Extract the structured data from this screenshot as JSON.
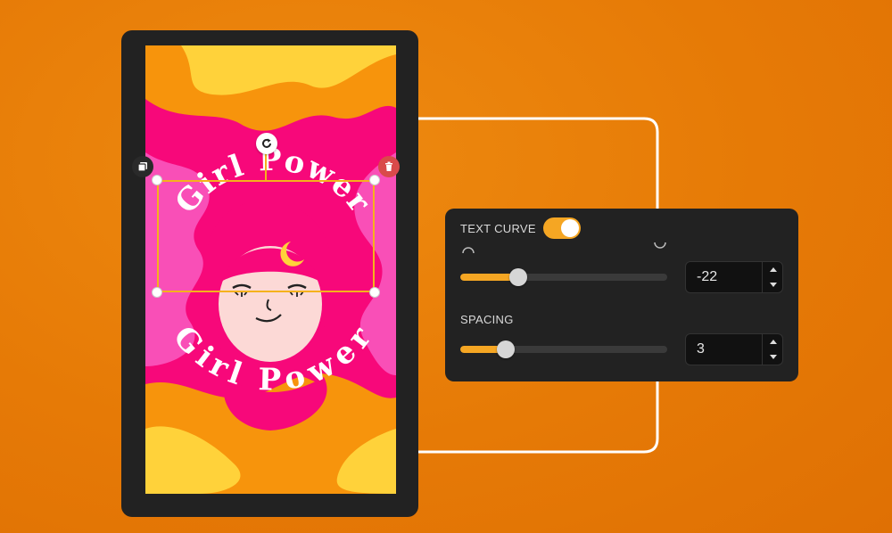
{
  "canvas": {
    "text_line_top": "Girl Power",
    "text_line_bottom": "Girl Power"
  },
  "toolbar": {
    "rotate_icon": "rotate-icon",
    "duplicate_icon": "duplicate-icon",
    "delete_icon": "trash-icon"
  },
  "panel": {
    "text_curve": {
      "label": "TEXT CURVE",
      "enabled": true,
      "value": "-22",
      "slider_fraction": 0.28,
      "left_icon": "arc-up-icon",
      "right_icon": "arc-down-icon"
    },
    "spacing": {
      "label": "SPACING",
      "value": "3",
      "slider_fraction": 0.22
    }
  },
  "colors": {
    "accent": "#f5a623",
    "panel_bg": "#222222",
    "background": "#e67a06",
    "pink": "#f7087a",
    "delete": "#d94a4a"
  }
}
